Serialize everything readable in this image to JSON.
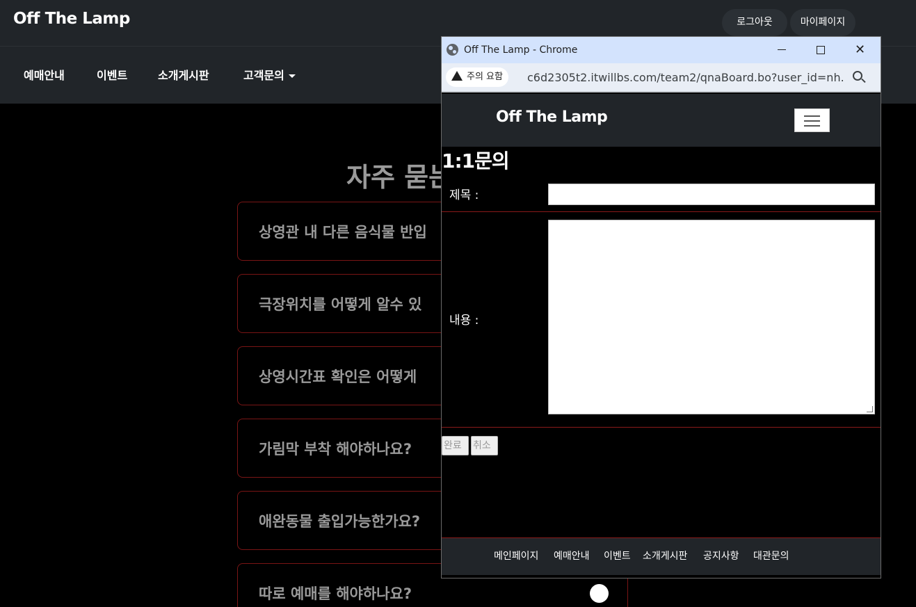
{
  "site": {
    "brand": "Off The Lamp",
    "top_buttons": {
      "logout": "로그아웃",
      "mypage": "마이페이지"
    },
    "nav": [
      "예매안내",
      "이벤트",
      "소개게시판",
      "고객문의"
    ],
    "faq_title": "자주 묻는",
    "faq_items": [
      "상영관 내 다른 음식물 반입",
      "극장위치를 어떻게 알수 있",
      "상영시간표 확인은 어떻게",
      "가림막 부착 해야하나요?",
      "애완동물 출입가능한가요?",
      "따로 예매를 해야하나요?"
    ]
  },
  "popup": {
    "window_title": "Off The Lamp - Chrome",
    "security_chip": "주의 요함",
    "url": "c6d2305t2.itwillbs.com/team2/qnaBoard.bo?user_id=nh...",
    "brand": "Off The Lamp",
    "form_title": "1:1문의",
    "subject_label": "제목 :",
    "content_label": "내용 :",
    "subject_value": "",
    "content_value": "",
    "submit_label": "완료",
    "cancel_label": "취소",
    "footer_links": [
      "메인페이지",
      "예매안내",
      "이벤트",
      "소개게시판",
      "공지사항",
      "대관문의"
    ]
  }
}
